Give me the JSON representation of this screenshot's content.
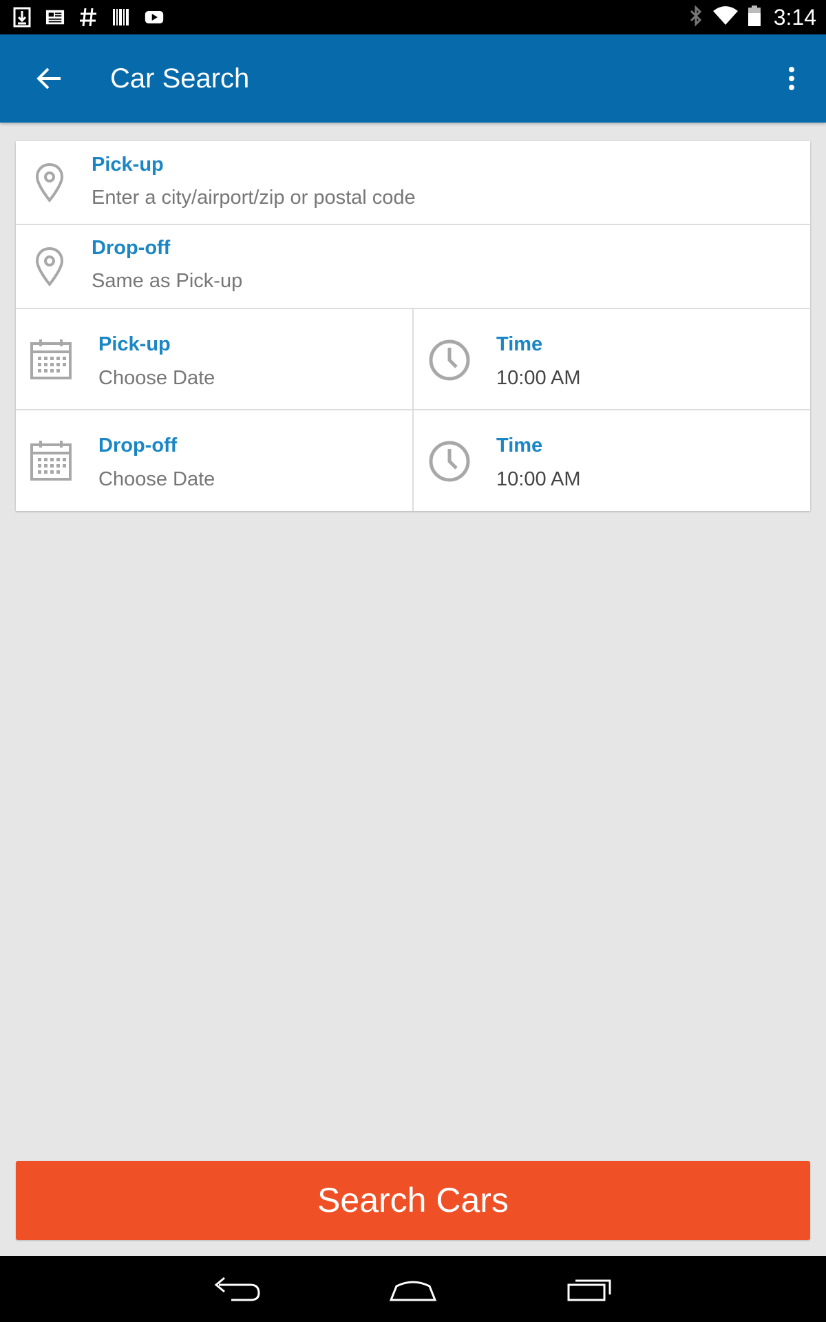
{
  "status_bar": {
    "time": "3:14",
    "left_icons": [
      "download-icon",
      "news-icon",
      "hashtag-icon",
      "barcode-icon",
      "youtube-icon"
    ],
    "right_icons": [
      "bluetooth-icon",
      "wifi-icon",
      "battery-icon"
    ]
  },
  "app_bar": {
    "title": "Car Search",
    "back_icon": "arrow-back-icon",
    "menu_icon": "more-vert-icon",
    "color": "#066aab"
  },
  "form": {
    "pickup_location": {
      "label": "Pick-up",
      "placeholder": "Enter a city/airport/zip or postal code",
      "icon": "location-pin-icon"
    },
    "dropoff_location": {
      "label": "Drop-off",
      "value": "Same as Pick-up",
      "icon": "location-pin-icon"
    },
    "pickup_date": {
      "label": "Pick-up",
      "value": "Choose Date",
      "icon": "calendar-icon"
    },
    "pickup_time": {
      "label": "Time",
      "value": "10:00 AM",
      "icon": "clock-icon"
    },
    "dropoff_date": {
      "label": "Drop-off",
      "value": "Choose Date",
      "icon": "calendar-icon"
    },
    "dropoff_time": {
      "label": "Time",
      "value": "10:00 AM",
      "icon": "clock-icon"
    },
    "label_color": "#1a86c4"
  },
  "search_button": {
    "label": "Search Cars",
    "color": "#f05025"
  },
  "nav_bar": {
    "icons": [
      "nav-back-icon",
      "nav-home-icon",
      "nav-recents-icon"
    ]
  }
}
